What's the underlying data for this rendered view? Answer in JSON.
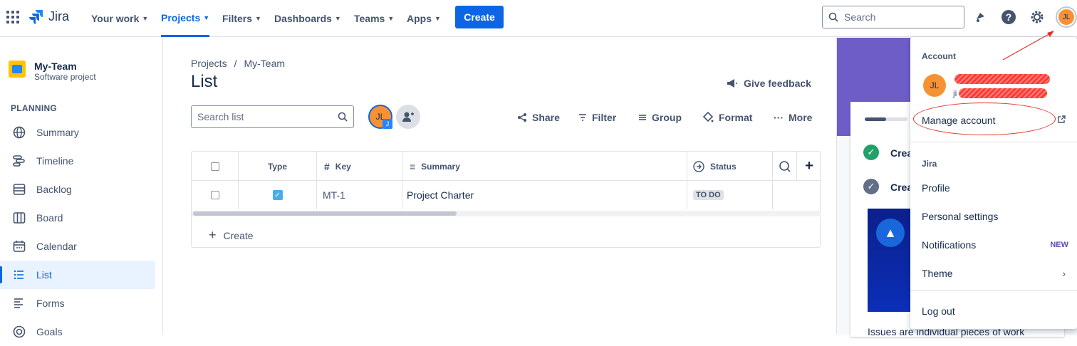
{
  "topnav": {
    "logo_text": "Jira",
    "items": [
      {
        "label": "Your work",
        "active": false
      },
      {
        "label": "Projects",
        "active": true
      },
      {
        "label": "Filters",
        "active": false
      },
      {
        "label": "Dashboards",
        "active": false
      },
      {
        "label": "Teams",
        "active": false
      },
      {
        "label": "Apps",
        "active": false
      }
    ],
    "create_label": "Create",
    "search_placeholder": "Search",
    "avatar_initials": "JL"
  },
  "sidebar": {
    "project_name": "My-Team",
    "project_type": "Software project",
    "section_label": "PLANNING",
    "items": [
      {
        "label": "Summary",
        "icon": "globe-icon"
      },
      {
        "label": "Timeline",
        "icon": "timeline-icon"
      },
      {
        "label": "Backlog",
        "icon": "backlog-icon"
      },
      {
        "label": "Board",
        "icon": "board-icon"
      },
      {
        "label": "Calendar",
        "icon": "calendar-icon"
      },
      {
        "label": "List",
        "icon": "list-icon",
        "active": true
      },
      {
        "label": "Forms",
        "icon": "forms-icon"
      },
      {
        "label": "Goals",
        "icon": "goals-icon"
      }
    ]
  },
  "main": {
    "breadcrumb": [
      "Projects",
      "My-Team"
    ],
    "title": "List",
    "feedback_label": "Give feedback",
    "search_placeholder": "Search list",
    "avatar_initials": "JL",
    "avatar_badge": "J",
    "toolbar": {
      "share": "Share",
      "filter": "Filter",
      "group": "Group",
      "format": "Format",
      "more": "More"
    },
    "table": {
      "headers": [
        "Type",
        "Key",
        "Summary",
        "Status"
      ],
      "rows": [
        {
          "key": "MT-1",
          "summary": "Project Charter",
          "status": "TO DO"
        }
      ],
      "create_label": "Create"
    }
  },
  "right_panel": {
    "item1": "Crea",
    "item2": "Crea",
    "bottom_text": "Issues are individual pieces of work"
  },
  "account_menu": {
    "account_heading": "Account",
    "avatar_initials": "JL",
    "email_fragment": "ji",
    "manage_account": "Manage account",
    "jira_heading": "Jira",
    "profile": "Profile",
    "personal_settings": "Personal settings",
    "notifications": "Notifications",
    "new_badge": "NEW",
    "theme": "Theme",
    "logout": "Log out"
  },
  "colors": {
    "brand": "#0c66e4",
    "avatar": "#f79233",
    "annotation_red": "#e2322b"
  }
}
